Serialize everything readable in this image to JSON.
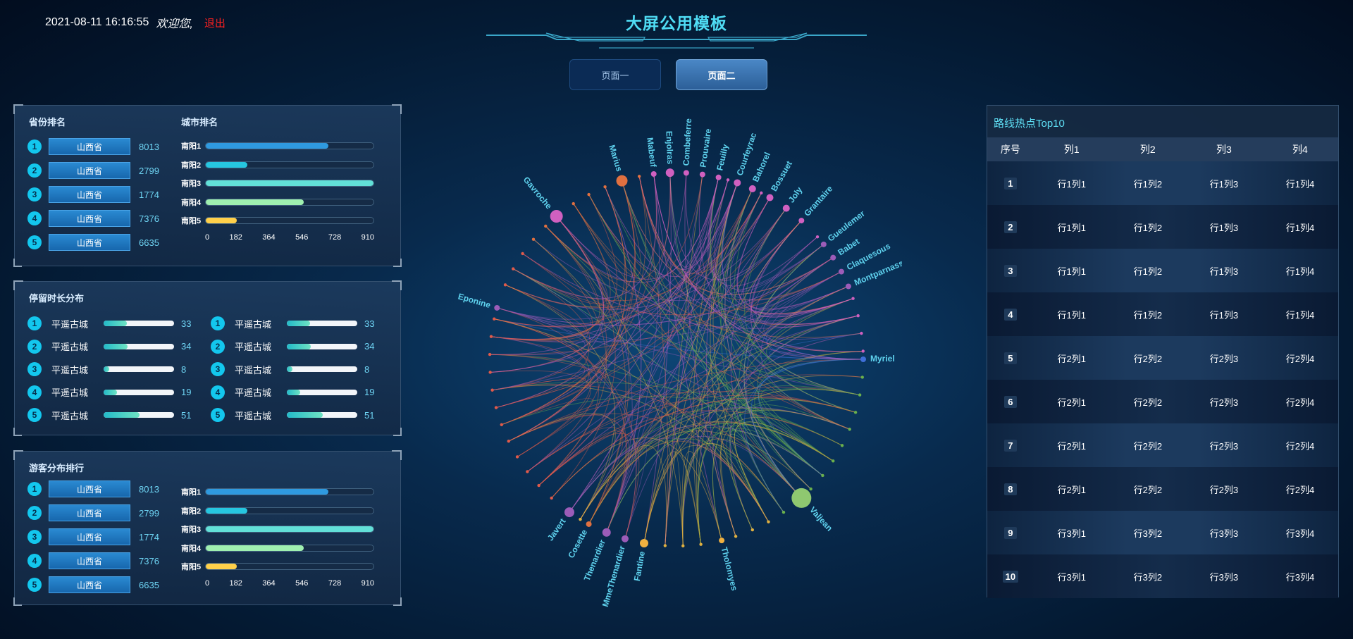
{
  "header": {
    "datetime": "2021-08-11 16:16:55",
    "welcome": "欢迎您,",
    "logout": "退出",
    "title": "大屏公用模板"
  },
  "tabs": [
    {
      "label": "页面一",
      "active": false
    },
    {
      "label": "页面二",
      "active": true
    }
  ],
  "province_panel": {
    "title_left": "省份排名",
    "title_right": "城市排名",
    "provinces": [
      {
        "rank": "1",
        "name": "山西省",
        "value": "8013"
      },
      {
        "rank": "2",
        "name": "山西省",
        "value": "2799"
      },
      {
        "rank": "3",
        "name": "山西省",
        "value": "1774"
      },
      {
        "rank": "4",
        "name": "山西省",
        "value": "7376"
      },
      {
        "rank": "5",
        "name": "山西省",
        "value": "6635"
      }
    ],
    "cities": [
      {
        "label": "南阳1",
        "value": 665,
        "color": "#2f9ae0"
      },
      {
        "label": "南阳2",
        "value": 225,
        "color": "#26c6e0"
      },
      {
        "label": "南阳3",
        "value": 910,
        "color": "#62e0d8"
      },
      {
        "label": "南阳4",
        "value": 530,
        "color": "#9ff0b0"
      },
      {
        "label": "南阳5",
        "value": 170,
        "color": "#ffd04a"
      }
    ],
    "axis": [
      "0",
      "182",
      "364",
      "546",
      "728",
      "910"
    ],
    "max": 910
  },
  "stay_panel": {
    "title": "停留时长分布",
    "max": 100,
    "left": [
      {
        "rank": "1",
        "name": "平遥古城",
        "value": "33"
      },
      {
        "rank": "2",
        "name": "平遥古城",
        "value": "34"
      },
      {
        "rank": "3",
        "name": "平遥古城",
        "value": "8"
      },
      {
        "rank": "4",
        "name": "平遥古城",
        "value": "19"
      },
      {
        "rank": "5",
        "name": "平遥古城",
        "value": "51"
      }
    ],
    "right": [
      {
        "rank": "1",
        "name": "平遥古城",
        "value": "33"
      },
      {
        "rank": "2",
        "name": "平遥古城",
        "value": "34"
      },
      {
        "rank": "3",
        "name": "平遥古城",
        "value": "8"
      },
      {
        "rank": "4",
        "name": "平遥古城",
        "value": "19"
      },
      {
        "rank": "5",
        "name": "平遥古城",
        "value": "51"
      }
    ]
  },
  "tourist_panel": {
    "title": "游客分布排行",
    "provinces": [
      {
        "rank": "1",
        "name": "山西省",
        "value": "8013"
      },
      {
        "rank": "2",
        "name": "山西省",
        "value": "2799"
      },
      {
        "rank": "3",
        "name": "山西省",
        "value": "1774"
      },
      {
        "rank": "4",
        "name": "山西省",
        "value": "7376"
      },
      {
        "rank": "5",
        "name": "山西省",
        "value": "6635"
      }
    ],
    "cities": [
      {
        "label": "南阳1",
        "value": 665,
        "color": "#2f9ae0"
      },
      {
        "label": "南阳2",
        "value": 225,
        "color": "#26c6e0"
      },
      {
        "label": "南阳3",
        "value": 910,
        "color": "#62e0d8"
      },
      {
        "label": "南阳4",
        "value": 530,
        "color": "#9ff0b0"
      },
      {
        "label": "南阳5",
        "value": 170,
        "color": "#ffd04a"
      }
    ],
    "axis": [
      "0",
      "182",
      "364",
      "546",
      "728",
      "910"
    ],
    "max": 910
  },
  "graph": {
    "nodes": [
      {
        "name": "Myriel",
        "color": "#3f6fd8",
        "size": 4
      },
      {
        "name": "Valjean",
        "color": "#8fc870",
        "size": 14
      },
      {
        "name": "Tholomyes",
        "color": "#f0b040",
        "size": 4
      },
      {
        "name": "Fantine",
        "color": "#f0b040",
        "size": 6
      },
      {
        "name": "MmeThenardier",
        "color": "#9c5cb8",
        "size": 5
      },
      {
        "name": "Thenardier",
        "color": "#9c5cb8",
        "size": 6
      },
      {
        "name": "Cosette",
        "color": "#e07040",
        "size": 4
      },
      {
        "name": "Javert",
        "color": "#9c5cb8",
        "size": 7
      },
      {
        "name": "Eponine",
        "color": "#9c5cb8",
        "size": 4
      },
      {
        "name": "Gavroche",
        "color": "#d060c0",
        "size": 9
      },
      {
        "name": "Marius",
        "color": "#e07040",
        "size": 8
      },
      {
        "name": "Mabeuf",
        "color": "#d060c0",
        "size": 4
      },
      {
        "name": "Enjolras",
        "color": "#d060c0",
        "size": 6
      },
      {
        "name": "Combeferre",
        "color": "#d060c0",
        "size": 4
      },
      {
        "name": "Prouvaire",
        "color": "#d060c0",
        "size": 4
      },
      {
        "name": "Feuilly",
        "color": "#d060c0",
        "size": 4
      },
      {
        "name": "Courfeyrac",
        "color": "#d060c0",
        "size": 5
      },
      {
        "name": "Bahorel",
        "color": "#d060c0",
        "size": 5
      },
      {
        "name": "Bossuet",
        "color": "#d060c0",
        "size": 5
      },
      {
        "name": "Joly",
        "color": "#d060c0",
        "size": 5
      },
      {
        "name": "Grantaire",
        "color": "#d060c0",
        "size": 4
      },
      {
        "name": "Gueulemer",
        "color": "#9c5cb8",
        "size": 4
      },
      {
        "name": "Babet",
        "color": "#9c5cb8",
        "size": 4
      },
      {
        "name": "Claquesous",
        "color": "#9c5cb8",
        "size": 4
      },
      {
        "name": "Montparnasse",
        "color": "#9c5cb8",
        "size": 4
      }
    ]
  },
  "route_table": {
    "title": "路线热点Top10",
    "headers": [
      "序号",
      "列1",
      "列2",
      "列3",
      "列4"
    ],
    "rows": [
      [
        "1",
        "行1列1",
        "行1列2",
        "行1列3",
        "行1列4"
      ],
      [
        "2",
        "行1列1",
        "行1列2",
        "行1列3",
        "行1列4"
      ],
      [
        "3",
        "行1列1",
        "行1列2",
        "行1列3",
        "行1列4"
      ],
      [
        "4",
        "行1列1",
        "行1列2",
        "行1列3",
        "行1列4"
      ],
      [
        "5",
        "行2列1",
        "行2列2",
        "行2列3",
        "行2列4"
      ],
      [
        "6",
        "行2列1",
        "行2列2",
        "行2列3",
        "行2列4"
      ],
      [
        "7",
        "行2列1",
        "行2列2",
        "行2列3",
        "行2列4"
      ],
      [
        "8",
        "行2列1",
        "行2列2",
        "行2列3",
        "行2列4"
      ],
      [
        "9",
        "行3列1",
        "行3列2",
        "行3列3",
        "行3列4"
      ],
      [
        "10",
        "行3列1",
        "行3列2",
        "行3列3",
        "行3列4"
      ]
    ]
  }
}
